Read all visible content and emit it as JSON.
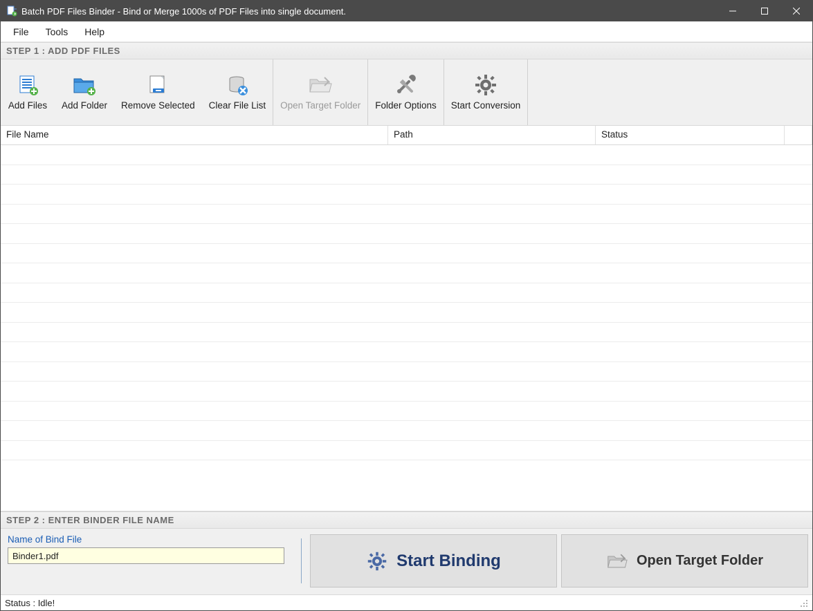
{
  "titlebar": {
    "title": "Batch PDF Files Binder - Bind or Merge 1000s of PDF Files into single document."
  },
  "menubar": {
    "items": [
      "File",
      "Tools",
      "Help"
    ]
  },
  "section1": {
    "header": "STEP 1 : ADD PDF FILES"
  },
  "toolbar": {
    "add_files": "Add Files",
    "add_folder": "Add Folder",
    "remove_selected": "Remove Selected",
    "clear_file_list": "Clear File List",
    "open_target_folder": "Open Target Folder",
    "folder_options": "Folder Options",
    "start_conversion": "Start Conversion"
  },
  "table": {
    "columns": {
      "filename": "File Name",
      "path": "Path",
      "status": "Status"
    },
    "rows": []
  },
  "section2": {
    "header": "STEP 2 : ENTER BINDER FILE NAME",
    "name_label": "Name of Bind File",
    "name_value": "Binder1.pdf",
    "start_binding": "Start Binding",
    "open_target_folder": "Open Target Folder"
  },
  "statusbar": {
    "text": "Status  :  Idle!"
  }
}
